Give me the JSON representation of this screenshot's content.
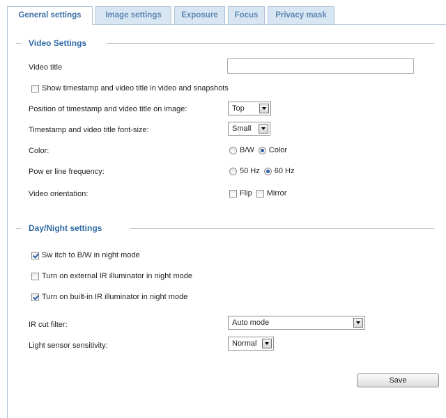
{
  "tabs": [
    {
      "label": "General settings",
      "active": true
    },
    {
      "label": "Image settings",
      "active": false
    },
    {
      "label": "Exposure",
      "active": false
    },
    {
      "label": "Focus",
      "active": false
    },
    {
      "label": "Privacy mask",
      "active": false
    }
  ],
  "video_settings": {
    "legend": "Video Settings",
    "video_title_label": "Video title",
    "video_title_value": "",
    "show_timestamp": {
      "label": "Show timestamp and video title in video and snapshots",
      "checked": false
    },
    "position": {
      "label": "Position of timestamp and video title on image:",
      "value": "Top"
    },
    "font_size": {
      "label": "Timestamp and video title font-size:",
      "value": "Small"
    },
    "color": {
      "label": "Color:",
      "options": [
        "B/W",
        "Color"
      ],
      "selected": "Color"
    },
    "power_line": {
      "label": "Pow er line frequency:",
      "options": [
        "50 Hz",
        "60 Hz"
      ],
      "selected": "60 Hz"
    },
    "orientation": {
      "label": "Video orientation:",
      "flip": {
        "label": "Flip",
        "checked": false
      },
      "mirror": {
        "label": "Mirror",
        "checked": false
      }
    }
  },
  "day_night": {
    "legend": "Day/Night settings",
    "switch_bw": {
      "label": "Sw itch to B/W in night mode",
      "checked": true
    },
    "external_ir": {
      "label": "Turn on external IR illuminator in night mode",
      "checked": false
    },
    "builtin_ir": {
      "label": "Turn on built-in IR illuminator in night mode",
      "checked": true
    },
    "ir_cut": {
      "label": "IR cut filter:",
      "value": "Auto mode"
    },
    "light_sensor": {
      "label": "Light sensor sensitivity:",
      "value": "Normal"
    }
  },
  "save_label": "Save",
  "colors": {
    "accent": "#2f6aa5",
    "tab_bg": "#d8e6f3",
    "tab_border": "#aebfd1"
  }
}
